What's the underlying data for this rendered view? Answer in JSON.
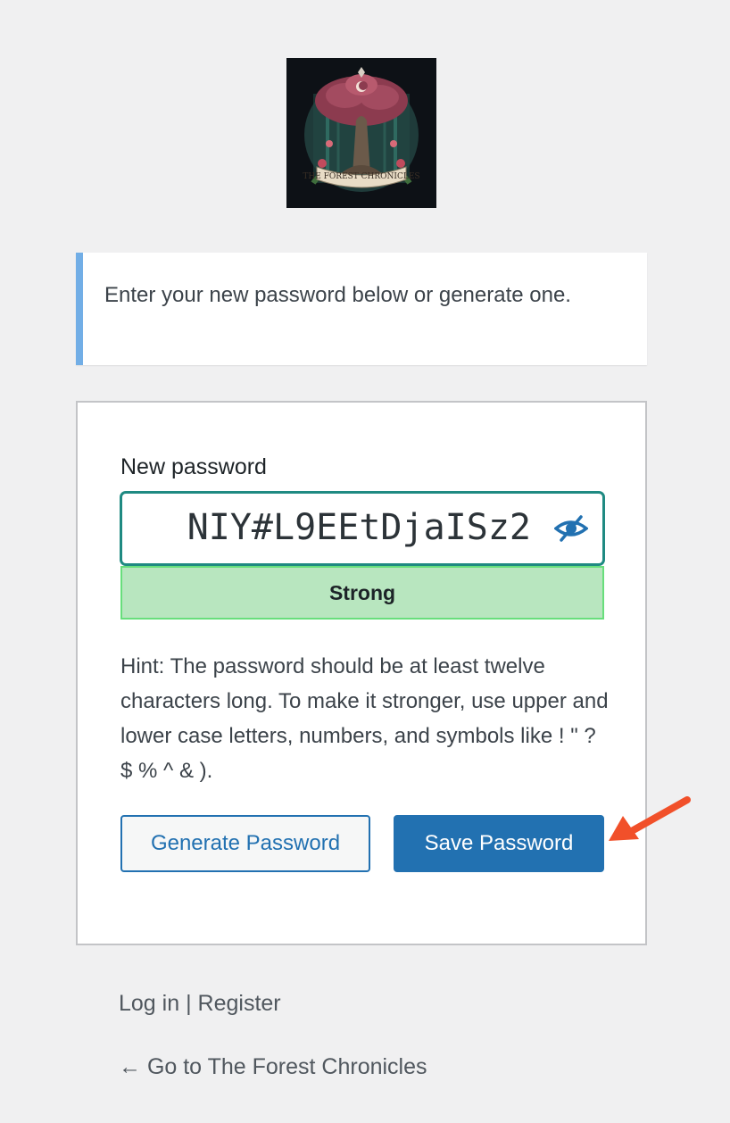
{
  "logo": {
    "alt_text": "THE FOREST CHRONICLES",
    "background_color": "#0d1116"
  },
  "message": {
    "text": "Enter your new password below or generate one.",
    "accent_color": "#72aee6"
  },
  "form": {
    "label": "New password",
    "password_value": "NIY#L9EEtDjaISz2",
    "toggle_icon": "eye-slash-icon",
    "strength": {
      "text": "Strong",
      "background_color": "#b8e6bf",
      "border_color": "#68de7c"
    },
    "hint": "Hint: The password should be at least twelve characters long. To make it stronger, use upper and lower case letters, numbers, and symbols like ! \" ? $ % ^ & ).",
    "generate_button": "Generate Password",
    "save_button": "Save Password",
    "primary_color": "#2271b1",
    "focus_color": "#1f8a82"
  },
  "annotation": {
    "icon": "arrow-pointer-icon",
    "color": "#f1502a"
  },
  "nav": {
    "login": "Log in",
    "separator": "|",
    "register": "Register",
    "back_link": "← Go to The Forest Chronicles"
  }
}
